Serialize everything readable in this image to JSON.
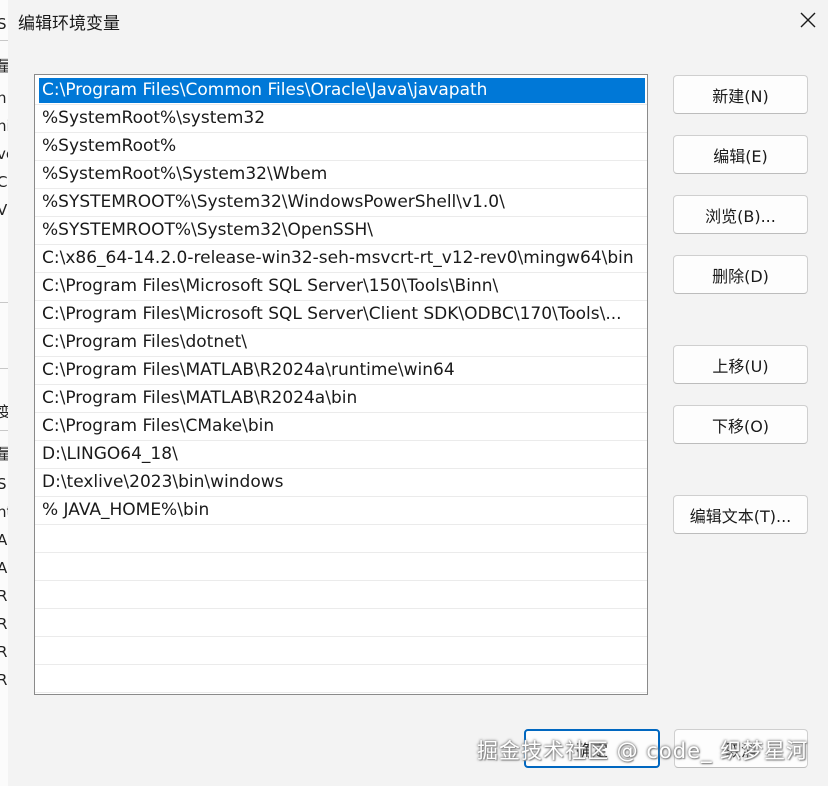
{
  "dialog": {
    "title": "编辑环境变量"
  },
  "background_window": {
    "fragments": [
      "S",
      "量",
      "n",
      "ni",
      "ve",
      "C:",
      "V",
      "变",
      "量",
      "S",
      "nt",
      "A",
      "A",
      "R",
      "R",
      "R",
      "R"
    ]
  },
  "path_list": {
    "entries": [
      "C:\\Program Files\\Common Files\\Oracle\\Java\\javapath",
      "%SystemRoot%\\system32",
      "%SystemRoot%",
      "%SystemRoot%\\System32\\Wbem",
      "%SYSTEMROOT%\\System32\\WindowsPowerShell\\v1.0\\",
      "%SYSTEMROOT%\\System32\\OpenSSH\\",
      "C:\\x86_64-14.2.0-release-win32-seh-msvcrt-rt_v12-rev0\\mingw64\\bin",
      "C:\\Program Files\\Microsoft SQL Server\\150\\Tools\\Binn\\",
      "C:\\Program Files\\Microsoft SQL Server\\Client SDK\\ODBC\\170\\Tools\\...",
      "C:\\Program Files\\dotnet\\",
      "C:\\Program Files\\MATLAB\\R2024a\\runtime\\win64",
      "C:\\Program Files\\MATLAB\\R2024a\\bin",
      "C:\\Program Files\\CMake\\bin",
      "D:\\LINGO64_18\\",
      "D:\\texlive\\2023\\bin\\windows",
      "% JAVA_HOME%\\bin",
      "",
      "",
      "",
      "",
      "",
      ""
    ],
    "selected_index": 0
  },
  "buttons": {
    "new": "新建(N)",
    "edit": "编辑(E)",
    "browse": "浏览(B)...",
    "delete": "删除(D)",
    "move_up": "上移(U)",
    "move_down": "下移(O)",
    "edit_text": "编辑文本(T)...",
    "ok": "确定",
    "cancel": "取消"
  },
  "watermark": "掘金技术社区 @ code_ 织梦星河",
  "colors": {
    "selection": "#0078d7",
    "default_button_border": "#0067c0",
    "dialog_bg": "#f3f3f3"
  },
  "icons": {
    "close": "close-icon"
  }
}
